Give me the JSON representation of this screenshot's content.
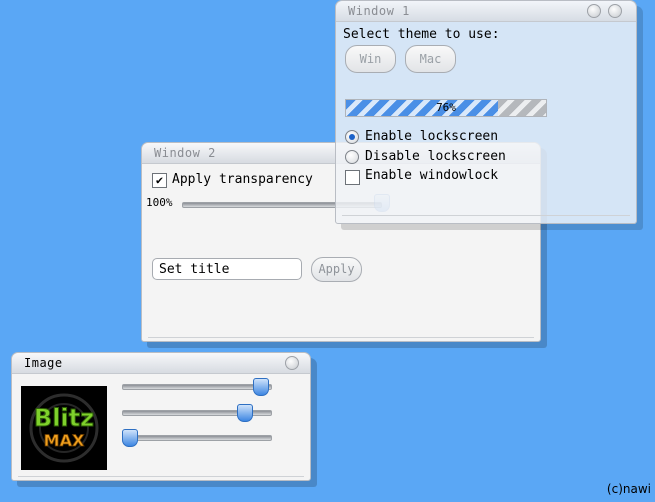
{
  "window1": {
    "title": "Window 1",
    "theme_prompt": "Select theme to use:",
    "theme_buttons": [
      "Win",
      "Mac"
    ],
    "progress": {
      "value": 0.76,
      "label": "76%"
    },
    "radio_options": [
      {
        "label": "Enable lockscreen",
        "selected": true
      },
      {
        "label": "Disable lockscreen",
        "selected": false
      }
    ],
    "checkbox": {
      "label": "Enable windowlock",
      "checked": false
    }
  },
  "window2": {
    "title": "Window 2",
    "transparency_checkbox": {
      "label": "Apply transparency",
      "checked": true
    },
    "slider": {
      "label": "100%",
      "value": 1.0
    },
    "title_input": {
      "value": "Set title"
    },
    "apply_button": "Apply"
  },
  "image_window": {
    "title": "Image",
    "logo_text": {
      "top": "Blitz",
      "bottom": "MAX"
    },
    "sliders": [
      0.98,
      0.86,
      0.0
    ]
  },
  "copyright": "(c)nawi",
  "colors": {
    "desktop": "#5aa7f5",
    "accent": "#3d86e2"
  }
}
